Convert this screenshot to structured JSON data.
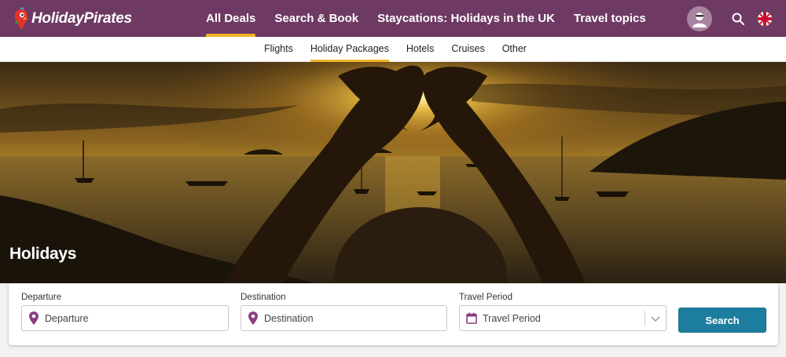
{
  "brand": {
    "name": "HolidayPirates"
  },
  "main_nav": {
    "items": [
      {
        "label": "All Deals",
        "active": true
      },
      {
        "label": "Search & Book",
        "active": false
      },
      {
        "label": "Staycations: Holidays in the UK",
        "active": false
      },
      {
        "label": "Travel topics",
        "active": false
      }
    ]
  },
  "top_right": {
    "icons": [
      "user-avatar-icon",
      "search-icon",
      "uk-flag-icon"
    ]
  },
  "sub_nav": {
    "items": [
      {
        "label": "Flights",
        "active": false
      },
      {
        "label": "Holiday Packages",
        "active": true
      },
      {
        "label": "Hotels",
        "active": false
      },
      {
        "label": "Cruises",
        "active": false
      },
      {
        "label": "Other",
        "active": false
      }
    ]
  },
  "hero": {
    "title": "Holidays"
  },
  "search_form": {
    "departure": {
      "label": "Departure",
      "placeholder": "Departure",
      "icon": "location-pin-icon"
    },
    "destination": {
      "label": "Destination",
      "placeholder": "Destination",
      "icon": "location-pin-icon"
    },
    "travel_period": {
      "label": "Travel Period",
      "value": "Travel Period",
      "icon": "calendar-icon"
    },
    "search_label": "Search"
  },
  "colors": {
    "brand_purple": "#6e3a63",
    "accent_yellow": "#f0b429",
    "search_button": "#1d7d9f",
    "icon_purple": "#8b3d7f"
  }
}
